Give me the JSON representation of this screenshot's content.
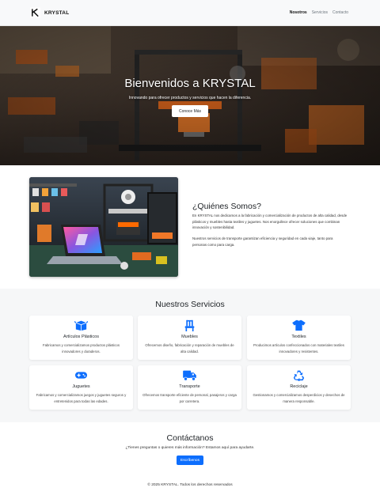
{
  "nav": {
    "brand": "KRYSTAL",
    "links": [
      "Nosotros",
      "Servicios",
      "Contacto"
    ]
  },
  "hero": {
    "title": "Bienvenidos a KRYSTAL",
    "subtitle": "Innovando para ofrecer productos y servicios que hacen la diferencia.",
    "button": "Conoce Más"
  },
  "about": {
    "title": "¿Quiénes Somos?",
    "p1": "En KRYSTAL nos dedicamos a la fabricación y comercialización de productos de alta calidad, desde plásticos y muebles hasta textiles y juguetes. Nos enorgullece ofrecer soluciones que combinan innovación y sostenibilidad.",
    "p2": "Nuestros servicios de transporte garantizan eficiencia y seguridad en cada viaje, tanto para personas como para carga."
  },
  "services": {
    "title": "Nuestros Servicios",
    "items": [
      {
        "title": "Artículos Plásticos",
        "text": "Fabricamos y comercializamos productos plásticos innovadores y duraderos.",
        "icon": "box-open-icon"
      },
      {
        "title": "Muebles",
        "text": "Ofrecemos diseño, fabricación y reparación de muebles de alta calidad.",
        "icon": "chair-icon"
      },
      {
        "title": "Textiles",
        "text": "Producimos artículos confeccionados con materiales textiles innovadores y resistentes.",
        "icon": "tshirt-icon"
      },
      {
        "title": "Juguetes",
        "text": "Fabricamos y comercializamos juegos y juguetes seguros y entretenidos para todas las edades.",
        "icon": "gamepad-icon"
      },
      {
        "title": "Transporte",
        "text": "Ofrecemos transporte eficiente de personal, pasajeros y carga por carretera.",
        "icon": "truck-icon"
      },
      {
        "title": "Reciclaje",
        "text": "Gestionamos y comercializamos desperdicios y desechos de manera responsable.",
        "icon": "recycle-icon"
      }
    ]
  },
  "contact": {
    "title": "Contáctanos",
    "text": "¿Tienes preguntas o quieres más información? Estamos aquí para ayudarte.",
    "button": "Escríbenos"
  },
  "footer": {
    "text": "© 2025 KRYSTAL. Todos los derechos reservados"
  },
  "colors": {
    "accent": "#0d6efd",
    "navbar_bg": "#f8f9fa",
    "services_bg": "#f6f7f8"
  }
}
